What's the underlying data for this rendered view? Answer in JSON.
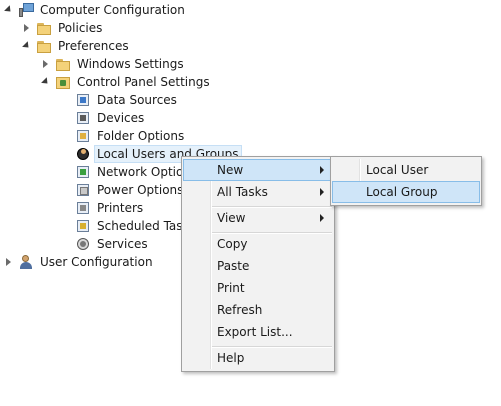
{
  "tree": {
    "computer_configuration": "Computer Configuration",
    "policies": "Policies",
    "preferences": "Preferences",
    "windows_settings": "Windows Settings",
    "control_panel_settings": "Control Panel Settings",
    "data_sources": "Data Sources",
    "devices": "Devices",
    "folder_options": "Folder Options",
    "local_users_and_groups": "Local Users and Groups",
    "network_options": "Network Options",
    "power_options": "Power Options",
    "printers": "Printers",
    "scheduled_tasks": "Scheduled Tasks",
    "services": "Services",
    "user_configuration": "User Configuration"
  },
  "context_menu": {
    "new": "New",
    "all_tasks": "All Tasks",
    "view": "View",
    "copy": "Copy",
    "paste": "Paste",
    "print": "Print",
    "refresh": "Refresh",
    "export_list": "Export List...",
    "help": "Help"
  },
  "submenu": {
    "local_user": "Local User",
    "local_group": "Local Group"
  },
  "colors": {
    "menu_background": "#f2f2f2",
    "menu_highlight": "#cfe5f8",
    "selection": "#e5f1fb"
  }
}
